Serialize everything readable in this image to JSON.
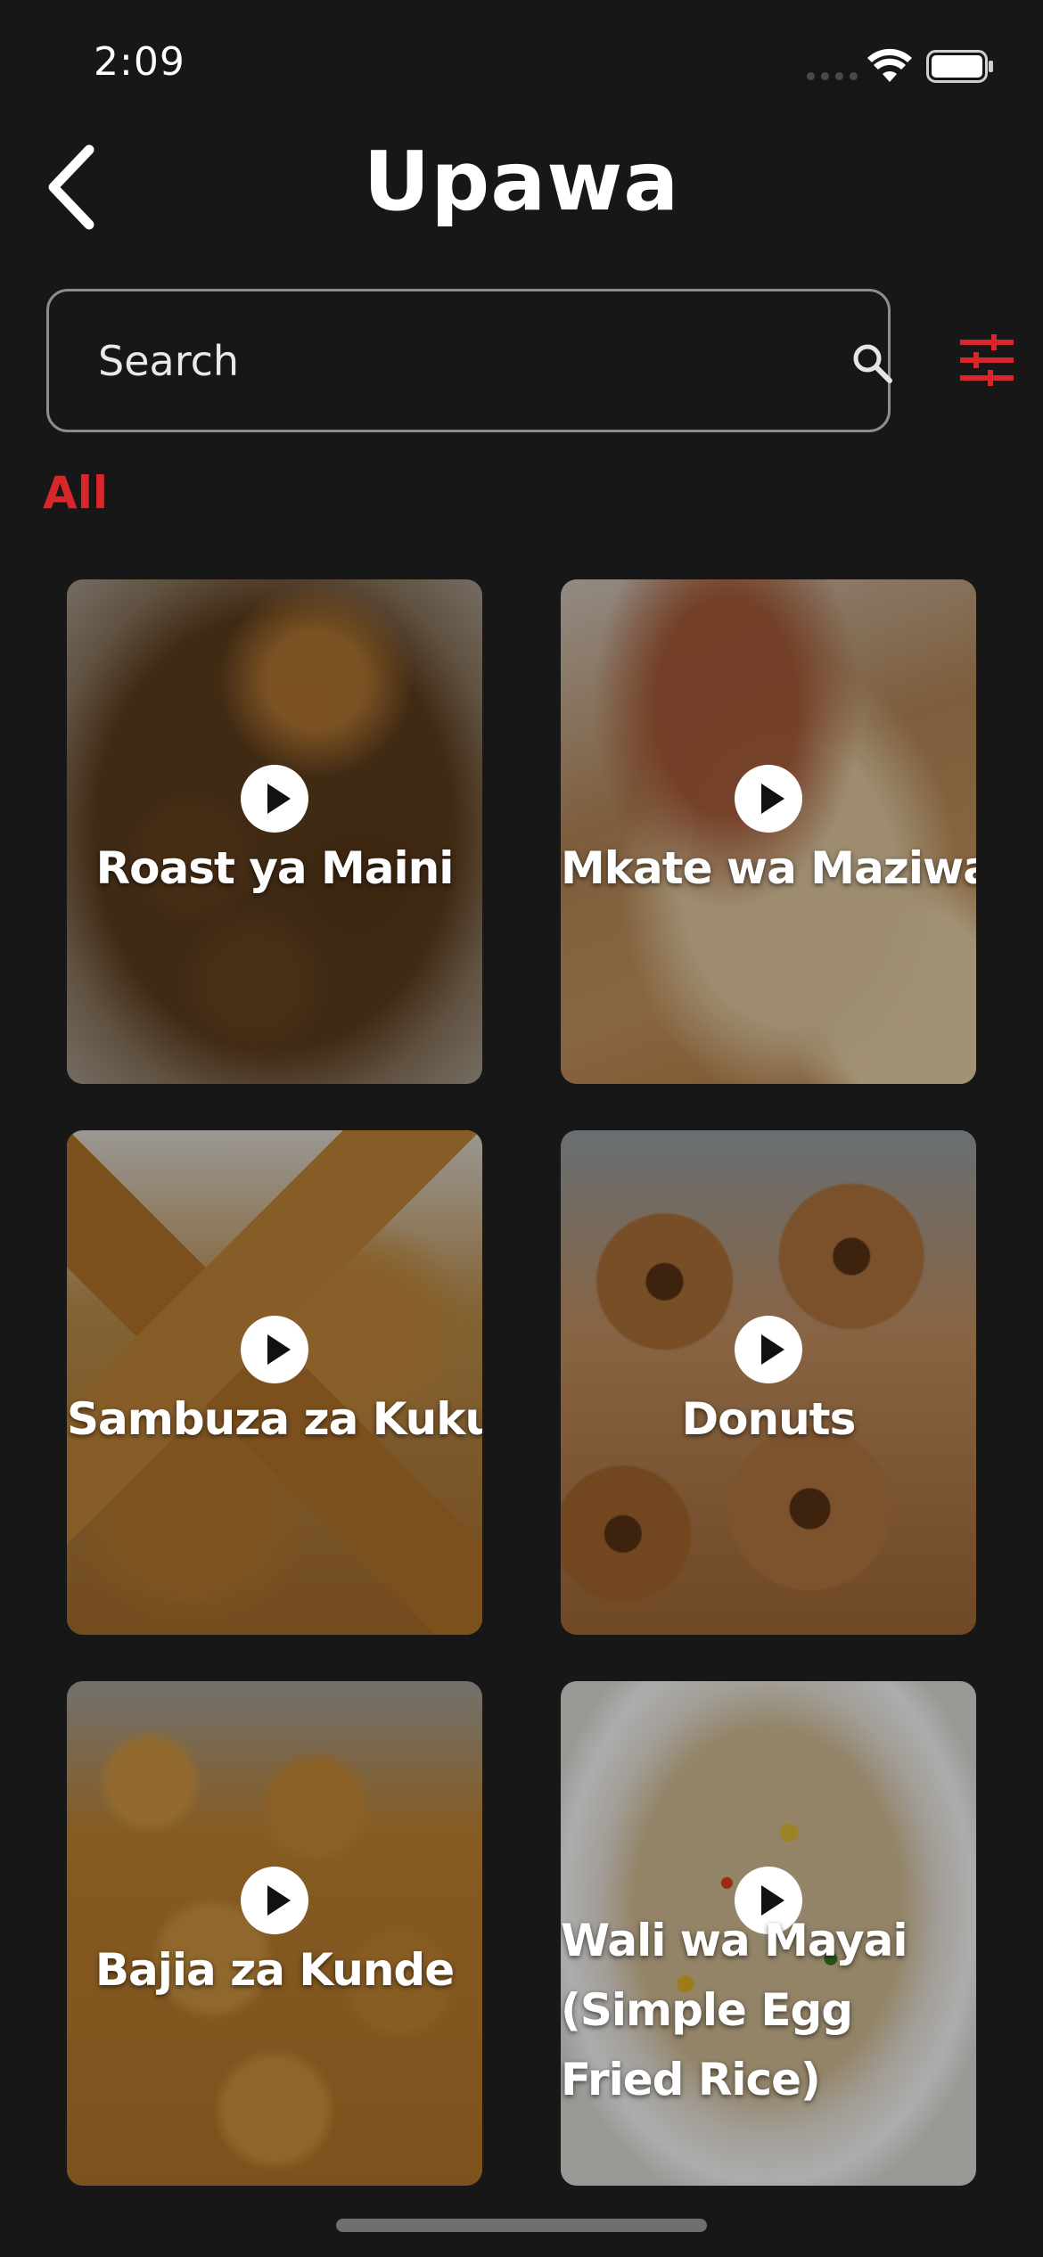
{
  "status_bar": {
    "time": "2:09"
  },
  "header": {
    "title": "Upawa"
  },
  "search": {
    "placeholder": "Search"
  },
  "categories": {
    "active": "All"
  },
  "colors": {
    "accent": "#d8262a",
    "background": "#171717"
  },
  "recipes": [
    {
      "title": "Roast ya Maini"
    },
    {
      "title": "Mkate wa Maziwa"
    },
    {
      "title": "Sambuza za Kuku"
    },
    {
      "title": "Donuts"
    },
    {
      "title": "Bajia za Kunde"
    },
    {
      "title": "Wali wa Mayai (Simple Egg Fried Rice)"
    }
  ]
}
